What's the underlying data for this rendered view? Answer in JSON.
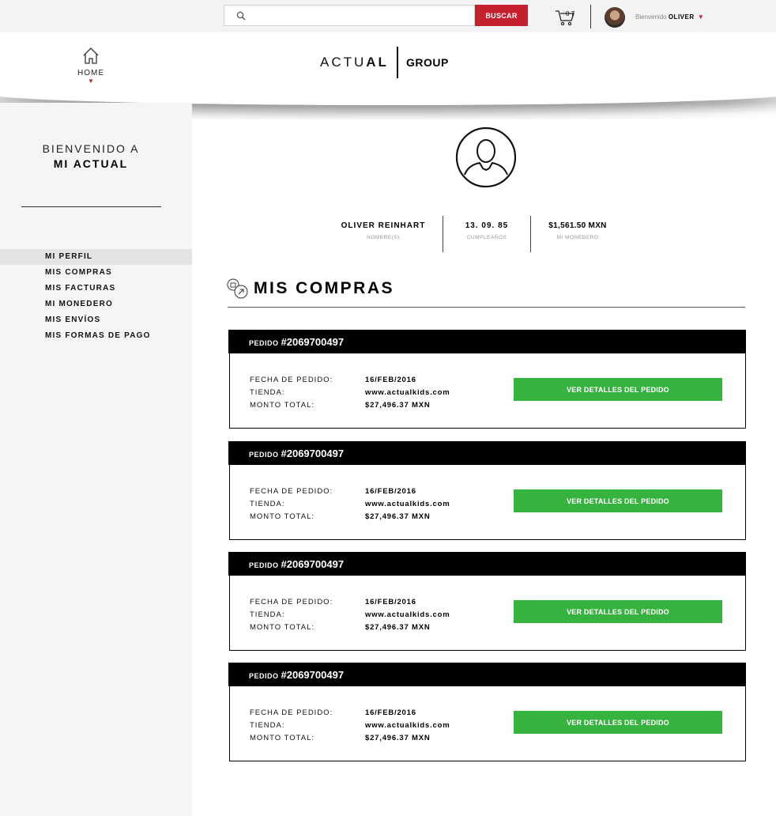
{
  "search": {
    "placeholder": "",
    "button_label": "BUSCAR"
  },
  "cart": {
    "count": "0 7"
  },
  "user": {
    "greeting": "Bienvenido",
    "name": "OLIVER"
  },
  "nav": {
    "home_label": "HOME"
  },
  "brand": {
    "actual_light": "ACTU",
    "actual_bold": "AL",
    "group": "GROUP"
  },
  "sidebar": {
    "welcome_line1": "BIENVENIDO A",
    "welcome_line2": "MI ACTUAL",
    "items": [
      {
        "label": "MI PERFIL"
      },
      {
        "label": "MIS COMPRAS"
      },
      {
        "label": "MIS FACTURAS"
      },
      {
        "label": "MI MONEDERO"
      },
      {
        "label": "MIS ENVÍOS"
      },
      {
        "label": "MIS FORMAS DE PAGO"
      }
    ],
    "active_index": 0
  },
  "profile": {
    "name": "OLIVER REINHART",
    "name_label": "NOMBRE(S)",
    "birthday": "13. 09. 85",
    "birthday_label": "CUMPLEAÑOS",
    "wallet": "$1,561.50 MXN",
    "wallet_label": "MI MONEDERO"
  },
  "section": {
    "title": "MIS COMPRAS"
  },
  "orders": [
    {
      "label": "PEDIDO",
      "number": "#2069700497",
      "date_label": "FECHA DE PEDIDO:",
      "date": "16/FEB/2016",
      "store_label": "TIENDA:",
      "store": "www.actualkids.com",
      "total_label": "MONTO TOTAL:",
      "total": "$27,496.37 MXN",
      "button": "VER DETALLES DEL PEDIDO"
    },
    {
      "label": "PEDIDO",
      "number": "#2069700497",
      "date_label": "FECHA DE PEDIDO:",
      "date": "16/FEB/2016",
      "store_label": "TIENDA:",
      "store": "www.actualkids.com",
      "total_label": "MONTO TOTAL:",
      "total": "$27,496.37 MXN",
      "button": "VER DETALLES DEL PEDIDO"
    },
    {
      "label": "PEDIDO",
      "number": "#2069700497",
      "date_label": "FECHA DE PEDIDO:",
      "date": "16/FEB/2016",
      "store_label": "TIENDA:",
      "store": "www.actualkids.com",
      "total_label": "MONTO TOTAL:",
      "total": "$27,496.37 MXN",
      "button": "VER DETALLES DEL PEDIDO"
    },
    {
      "label": "PEDIDO",
      "number": "#2069700497",
      "date_label": "FECHA DE PEDIDO:",
      "date": "16/FEB/2016",
      "store_label": "TIENDA:",
      "store": "www.actualkids.com",
      "total_label": "MONTO TOTAL:",
      "total": "$27,496.37 MXN",
      "button": "VER DETALLES DEL PEDIDO"
    }
  ],
  "colors": {
    "accent_red": "#c5202e",
    "button_green": "#36b33f",
    "order_header": "#000000"
  },
  "icons": [
    "search-icon",
    "cart-icon",
    "home-icon",
    "chevron-down-icon",
    "user-profile-icon",
    "orders-icon"
  ]
}
